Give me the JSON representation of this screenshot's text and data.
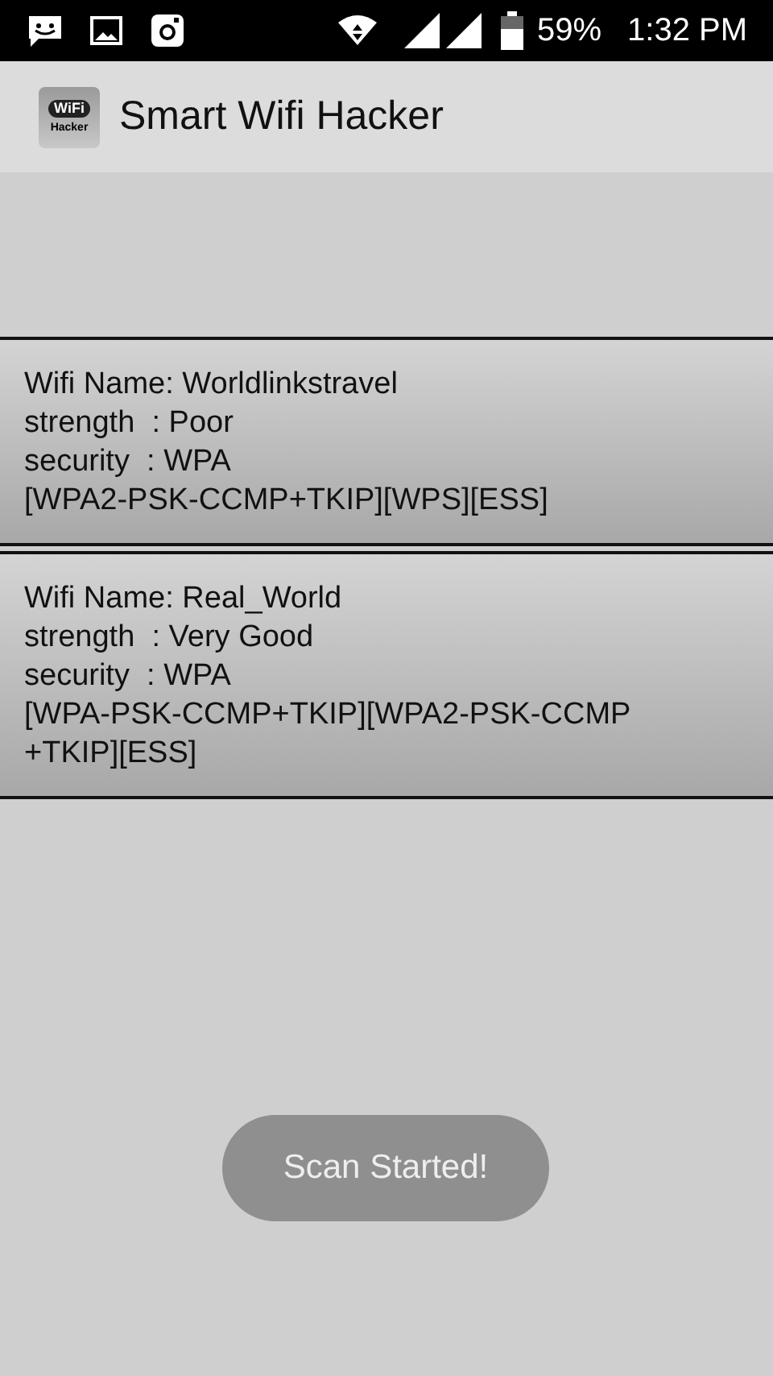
{
  "status_bar": {
    "battery": "59%",
    "time": "1:32 PM"
  },
  "app_bar": {
    "icon_texts": [
      "WiFi",
      "Hacker"
    ],
    "title": "Smart Wifi Hacker"
  },
  "networks": [
    {
      "lines": [
        "Wifi Name: Worldlinkstravel",
        "strength  : Poor",
        "security  : WPA",
        "[WPA2-PSK-CCMP+TKIP][WPS][ESS]"
      ]
    },
    {
      "lines": [
        "Wifi Name: Real_World",
        "strength  : Very Good",
        "security  : WPA",
        "[WPA-PSK-CCMP+TKIP][WPA2-PSK-CCMP",
        "+TKIP][ESS]"
      ]
    }
  ],
  "toast": "Scan Started!"
}
